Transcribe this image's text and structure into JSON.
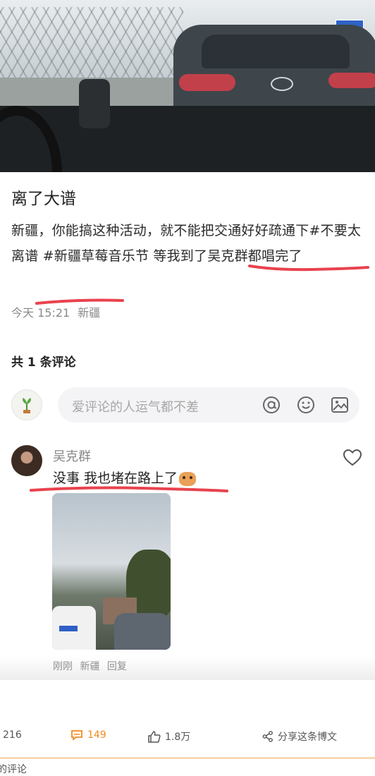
{
  "post": {
    "title": "离了大谱",
    "body": "新疆，你能搞这种活动，就不能把交通好好疏通下#不要太离谱 #新疆草莓音乐节 等我到了吴克群都唱完了",
    "time": "今天 15:21",
    "location": "新疆"
  },
  "comments": {
    "count_label": "共 1 条评论",
    "input_placeholder": "爱评论的人运气都不差",
    "items": [
      {
        "author": "吴克群",
        "text": "没事 我也堵在路上了",
        "time": "刚刚",
        "location": "新疆",
        "reply_label": "回复"
      }
    ]
  },
  "actions": {
    "repost_count": "216",
    "comment_count": "149",
    "like_count": "1.8万",
    "share_label": "分享这条博文"
  },
  "footer": {
    "partial_text": "的评论"
  },
  "colors": {
    "accent_orange": "#f08a1c",
    "underline_red": "#e8434e"
  },
  "icons": {
    "at": "at-icon",
    "emoji": "emoji-icon",
    "image": "image-icon",
    "heart": "heart-icon",
    "comment": "comment-icon",
    "like": "thumbs-up-icon",
    "share": "share-icon"
  }
}
